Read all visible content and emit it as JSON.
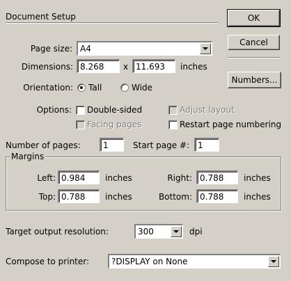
{
  "dialog": {
    "title": "Document Setup"
  },
  "buttons": {
    "ok": "OK",
    "cancel": "Cancel",
    "numbers": "Numbers..."
  },
  "page_size": {
    "label": "Page size:",
    "value": "A4"
  },
  "dimensions": {
    "label": "Dimensions:",
    "width": "8.268",
    "times": "x",
    "height": "11.693",
    "unit": "inches"
  },
  "orientation": {
    "label": "Orientation:",
    "tall": "Tall",
    "wide": "Wide",
    "selected": "Tall"
  },
  "options": {
    "label": "Options:",
    "double_sided": "Double-sided",
    "facing_pages": "Facing pages",
    "adjust_layout": "Adjust layout",
    "restart_numbering": "Restart page numbering"
  },
  "pages": {
    "num_label": "Number of pages:",
    "num_value": "1",
    "start_label": "Start page #:",
    "start_value": "1"
  },
  "margins": {
    "title": "Margins",
    "left_label": "Left:",
    "left_value": "0.984",
    "right_label": "Right:",
    "right_value": "0.788",
    "top_label": "Top:",
    "top_value": "0.788",
    "bottom_label": "Bottom:",
    "bottom_value": "0.788",
    "unit": "inches"
  },
  "resolution": {
    "label": "Target output resolution:",
    "value": "300",
    "unit": "dpi"
  },
  "printer": {
    "label": "Compose to printer:",
    "value": "?DISPLAY on None"
  }
}
